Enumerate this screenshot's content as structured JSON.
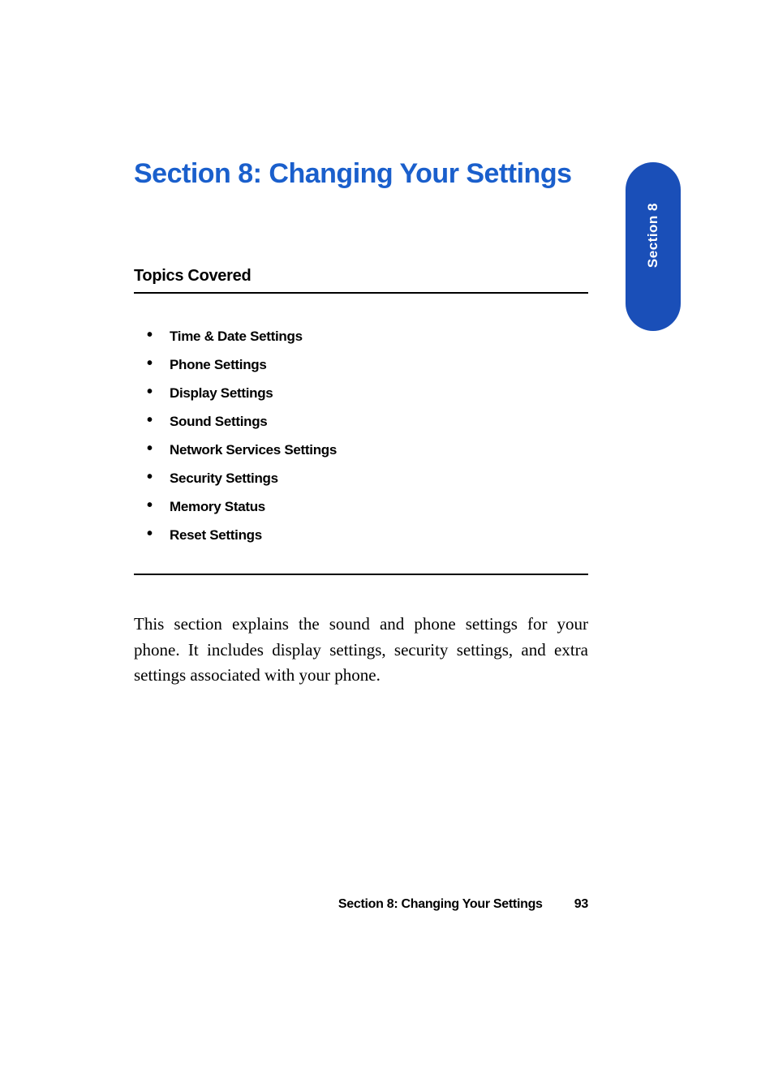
{
  "title": "Section 8: Changing Your Settings",
  "subheading": "Topics Covered",
  "topics": [
    "Time & Date Settings",
    "Phone Settings",
    "Display Settings",
    "Sound Settings",
    "Network Services Settings",
    "Security Settings",
    "Memory Status",
    "Reset Settings"
  ],
  "body": "This section explains the sound and phone settings for your phone. It includes display settings, security settings, and extra settings associated with your phone.",
  "sideTab": "Section 8",
  "footer": {
    "label": "Section 8: Changing Your Settings",
    "page": "93"
  }
}
